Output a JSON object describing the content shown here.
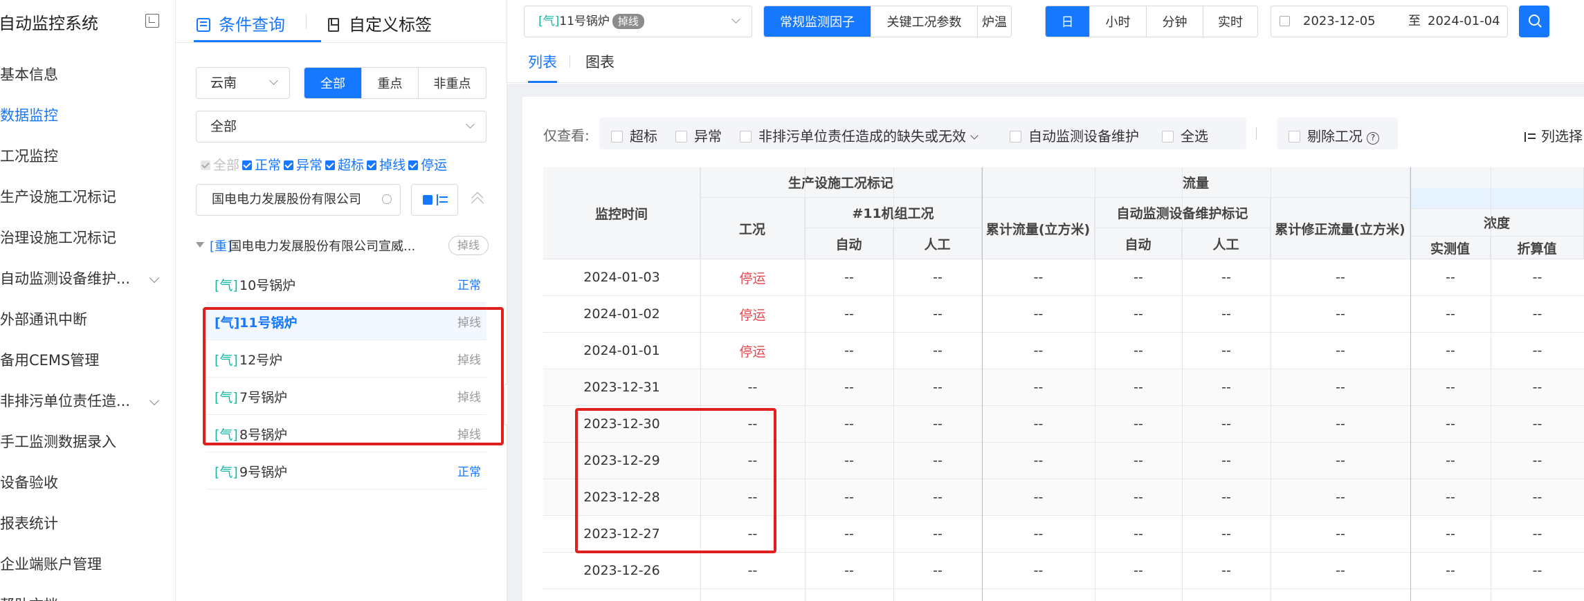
{
  "nav": {
    "title": "自动监控系统",
    "items": [
      {
        "label": "基本信息",
        "active": false,
        "has_children": false
      },
      {
        "label": "数据监控",
        "active": true,
        "has_children": false
      },
      {
        "label": "工况监控",
        "active": false,
        "has_children": false
      },
      {
        "label": "生产设施工况标记",
        "active": false,
        "has_children": false
      },
      {
        "label": "治理设施工况标记",
        "active": false,
        "has_children": false
      },
      {
        "label": "自动监测设备维护...",
        "active": false,
        "has_children": true
      },
      {
        "label": "外部通讯中断",
        "active": false,
        "has_children": false
      },
      {
        "label": "备用CEMS管理",
        "active": false,
        "has_children": false
      },
      {
        "label": "非排污单位责任造...",
        "active": false,
        "has_children": true
      },
      {
        "label": "手工监测数据录入",
        "active": false,
        "has_children": false
      },
      {
        "label": "设备验收",
        "active": false,
        "has_children": false
      },
      {
        "label": "报表统计",
        "active": false,
        "has_children": false
      },
      {
        "label": "企业端账户管理",
        "active": false,
        "has_children": false
      },
      {
        "label": "帮助文档",
        "active": false,
        "has_children": false
      }
    ]
  },
  "panel": {
    "tab_query": "条件查询",
    "tab_custom": "自定义标签",
    "region": "云南",
    "scope_buttons": [
      "全部",
      "重点",
      "非重点"
    ],
    "scope_selected": "全部",
    "category": "全部",
    "status_checks": [
      {
        "label": "全部",
        "disabled": true
      },
      {
        "label": "正常",
        "disabled": false
      },
      {
        "label": "异常",
        "disabled": false
      },
      {
        "label": "超标",
        "disabled": false
      },
      {
        "label": "掉线",
        "disabled": false
      },
      {
        "label": "停运",
        "disabled": false
      }
    ],
    "company_search": "国电电力发展股份有限公司",
    "tree_root": {
      "tag": "[重]",
      "name": "国电电力发展股份有限公司宣威...",
      "status": "掉线"
    },
    "devices": [
      {
        "type": "[气]",
        "name": "10号锅炉",
        "status": "正常",
        "ok": true,
        "selected": false
      },
      {
        "type": "[气]",
        "name": "11号锅炉",
        "status": "掉线",
        "ok": false,
        "selected": true
      },
      {
        "type": "[气]",
        "name": "12号炉",
        "status": "掉线",
        "ok": false,
        "selected": false
      },
      {
        "type": "[气]",
        "name": "7号锅炉",
        "status": "掉线",
        "ok": false,
        "selected": false
      },
      {
        "type": "[气]",
        "name": "8号锅炉",
        "status": "掉线",
        "ok": false,
        "selected": false
      },
      {
        "type": "[气]",
        "name": "9号锅炉",
        "status": "正常",
        "ok": true,
        "selected": false
      }
    ]
  },
  "toolbar": {
    "device_type": "[气]",
    "device_name": "11号锅炉",
    "device_badge": "掉线",
    "factor_buttons": [
      "常规监测因子",
      "关键工况参数",
      "炉温"
    ],
    "factor_selected": "常规监测因子",
    "period_buttons": [
      "日",
      "小时",
      "分钟",
      "实时"
    ],
    "period_selected": "日",
    "date_from": "2023-12-05",
    "date_sep": "至",
    "date_to": "2024-01-04"
  },
  "view_tabs": {
    "list": "列表",
    "chart": "图表"
  },
  "filters": {
    "label": "仅查看:",
    "checks": [
      "超标",
      "异常",
      "非排污单位责任造成的缺失或无效",
      "自动监测设备维护",
      "全选"
    ],
    "exclude": "剔除工况",
    "column_select": "列选择"
  },
  "table": {
    "headers": {
      "time": "监控时间",
      "group_prod": "生产设施工况标记",
      "status": "工况",
      "unit11": "#11机组工况",
      "auto": "自动",
      "manual": "人工",
      "group_flow": "流量",
      "cum_flow": "累计流量(立方米)",
      "maint": "自动监测设备维护标记",
      "auto2": "自动",
      "manual2": "人工",
      "cum_corr": "累计修正流量(立方米)",
      "conc": "浓度",
      "measured": "实测值",
      "converted": "折算值"
    },
    "rows": [
      {
        "date": "2024-01-03",
        "status": "停运",
        "stopped": true
      },
      {
        "date": "2024-01-02",
        "status": "停运",
        "stopped": true
      },
      {
        "date": "2024-01-01",
        "status": "停运",
        "stopped": true
      },
      {
        "date": "2023-12-31",
        "status": "--",
        "stopped": false
      },
      {
        "date": "2023-12-30",
        "status": "--",
        "stopped": false
      },
      {
        "date": "2023-12-29",
        "status": "--",
        "stopped": false
      },
      {
        "date": "2023-12-28",
        "status": "--",
        "stopped": false
      },
      {
        "date": "2023-12-27",
        "status": "--",
        "stopped": false
      },
      {
        "date": "2023-12-26",
        "status": "--",
        "stopped": false
      }
    ],
    "empty_value": "--"
  },
  "colors": {
    "accent": "#1677ff",
    "stop": "#e5484d",
    "device_type": "#14b8a6",
    "highlight": "#e02020"
  }
}
